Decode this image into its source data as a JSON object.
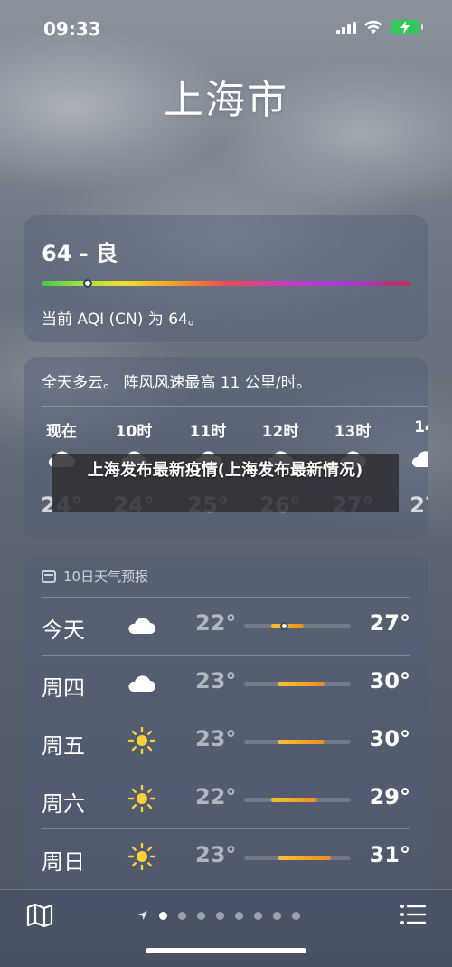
{
  "status_bar": {
    "time": "09:33"
  },
  "city": "上海市",
  "aqi": {
    "title": "64 - 良",
    "description": "当前 AQI (CN) 为 64。",
    "value": 64,
    "scale_max": 500
  },
  "hourly": {
    "summary": "全天多云。 阵风风速最高 11 公里/时。",
    "hours": [
      {
        "label": "现在",
        "temp": "24°",
        "icon": "cloud-icon"
      },
      {
        "label": "10时",
        "temp": "24°",
        "icon": "cloud-icon"
      },
      {
        "label": "11时",
        "temp": "25°",
        "icon": "cloud-icon"
      },
      {
        "label": "12时",
        "temp": "26°",
        "icon": "cloud-icon"
      },
      {
        "label": "13时",
        "temp": "27°",
        "icon": "cloud-icon"
      },
      {
        "label": "14",
        "temp": "27",
        "icon": "cloud-icon"
      }
    ]
  },
  "banner": {
    "text": "上海发布最新疫情(上海发布最新情况)"
  },
  "forecast": {
    "header": "10日天气预报",
    "range": {
      "min": 18,
      "max": 34
    },
    "days": [
      {
        "day": "今天",
        "icon": "cloud-icon",
        "low": "22°",
        "high": "27°",
        "low_val": 22,
        "high_val": 27,
        "now_val": 24
      },
      {
        "day": "周四",
        "icon": "cloud-icon",
        "low": "23°",
        "high": "30°",
        "low_val": 23,
        "high_val": 30
      },
      {
        "day": "周五",
        "icon": "sun-icon",
        "low": "23°",
        "high": "30°",
        "low_val": 23,
        "high_val": 30
      },
      {
        "day": "周六",
        "icon": "sun-icon",
        "low": "22°",
        "high": "29°",
        "low_val": 22,
        "high_val": 29
      },
      {
        "day": "周日",
        "icon": "sun-icon",
        "low": "23°",
        "high": "31°",
        "low_val": 23,
        "high_val": 31
      }
    ]
  },
  "bottom_bar": {
    "pages": 8,
    "active_page": 0
  },
  "colors": {
    "bar_yellow": "#f5c430",
    "bar_orange": "#f08a24",
    "battery": "#34c759"
  }
}
